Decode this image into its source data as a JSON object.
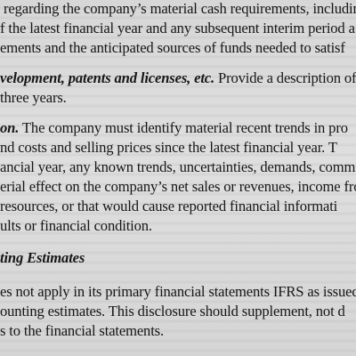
{
  "document": {
    "lines": [
      {
        "id": "l1",
        "text": "regarding the company’s material cash requirements, including"
      },
      {
        "id": "l2",
        "text": "f the latest financial year and any subsequent interim period a"
      },
      {
        "id": "l3",
        "text": "ements and the anticipated sources of funds needed to satisf"
      },
      {
        "id": "l4",
        "heading": "velopment, patents and licenses, etc.",
        "text": " Provide a description of th"
      },
      {
        "id": "l5",
        "text": "three years."
      },
      {
        "id": "l6",
        "heading": "on.",
        "text": " The company must identify material recent trends in pro"
      },
      {
        "id": "l7",
        "text": "nd costs and selling prices since the latest financial year.  T"
      },
      {
        "id": "l8",
        "text": "ancial year, any known trends, uncertainties, demands, comm"
      },
      {
        "id": "l9",
        "text": "erial effect on the company’s net sales or revenues, income fro"
      },
      {
        "id": "l10",
        "text": "resources, or that would cause reported financial informati"
      },
      {
        "id": "l11",
        "text": "ults or financial condition."
      },
      {
        "id": "l12",
        "heading": "ting Estimates",
        "text": ""
      },
      {
        "id": "l13",
        "text": "es not apply in its primary financial statements IFRS as issued"
      },
      {
        "id": "l14",
        "text": "ounting estimates.  This disclosure should supplement, not d"
      },
      {
        "id": "l15",
        "text": "s to the financial statements."
      }
    ]
  }
}
